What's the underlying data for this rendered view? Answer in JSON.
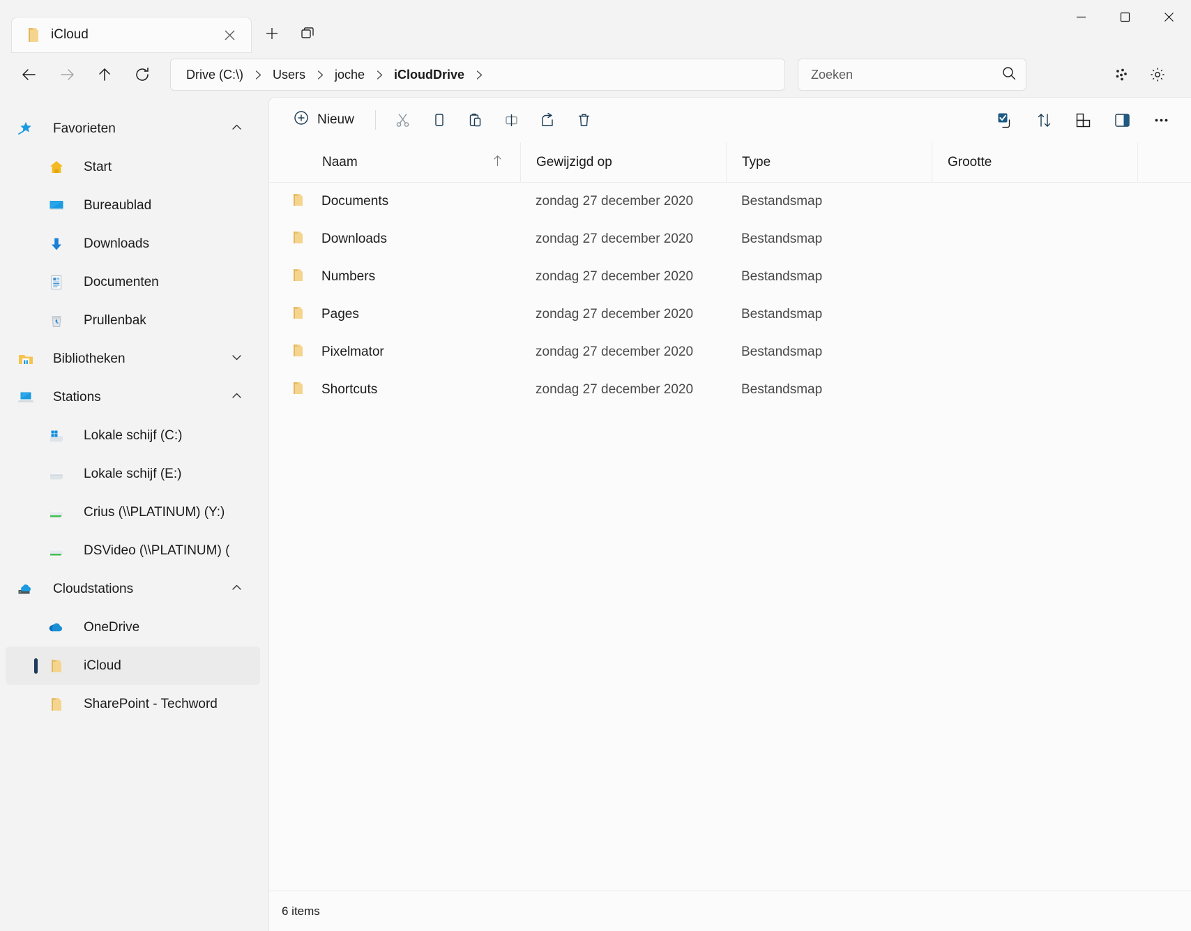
{
  "window": {
    "tab": {
      "title": "iCloud",
      "icon": "folder-icon",
      "close": "✕"
    },
    "controls": {
      "minimize": "minimize-icon",
      "maximize": "maximize-icon",
      "close": "close-icon"
    },
    "new_tab_label": "new-tab-icon",
    "tab_list_label": "tab-list-icon"
  },
  "navigation": {
    "back": "back-arrow-icon",
    "forward": "forward-arrow-icon",
    "up": "up-arrow-icon",
    "refresh": "refresh-icon",
    "breadcrumb": [
      {
        "label": "Drive (C:\\)",
        "current": false
      },
      {
        "label": "Users",
        "current": false
      },
      {
        "label": "joche",
        "current": false
      },
      {
        "label": "iCloudDrive",
        "current": true
      }
    ],
    "separator": "›"
  },
  "search": {
    "placeholder": "Zoeken",
    "value": "",
    "icon": "search-icon"
  },
  "addr_right": {
    "more": "details-dots-icon",
    "settings": "gear-icon"
  },
  "toolbar": {
    "new_label": "Nieuw",
    "new_icon": "plus-circle-icon",
    "cut": "cut-icon",
    "copy": "copy-icon",
    "paste": "paste-icon",
    "rename": "rename-icon",
    "share": "share-icon",
    "delete": "delete-icon",
    "select_all": "checkbox-select-icon",
    "sort": "sort-icon",
    "view": "view-layout-icon",
    "details_pane": "details-pane-icon",
    "more": "more-options-icon"
  },
  "columns": [
    {
      "key": "name",
      "label": "Naam",
      "sorted": "asc",
      "sort_icon": "↑"
    },
    {
      "key": "mod",
      "label": "Gewijzigd op"
    },
    {
      "key": "type",
      "label": "Type"
    },
    {
      "key": "size",
      "label": "Grootte"
    }
  ],
  "files": [
    {
      "name": "Documents",
      "modified": "zondag 27 december 2020",
      "type": "Bestandsmap",
      "size": "",
      "icon": "folder-icon"
    },
    {
      "name": "Downloads",
      "modified": "zondag 27 december 2020",
      "type": "Bestandsmap",
      "size": "",
      "icon": "folder-icon"
    },
    {
      "name": "Numbers",
      "modified": "zondag 27 december 2020",
      "type": "Bestandsmap",
      "size": "",
      "icon": "folder-icon"
    },
    {
      "name": "Pages",
      "modified": "zondag 27 december 2020",
      "type": "Bestandsmap",
      "size": "",
      "icon": "folder-icon"
    },
    {
      "name": "Pixelmator",
      "modified": "zondag 27 december 2020",
      "type": "Bestandsmap",
      "size": "",
      "icon": "folder-icon"
    },
    {
      "name": "Shortcuts",
      "modified": "zondag 27 december 2020",
      "type": "Bestandsmap",
      "size": "",
      "icon": "folder-icon"
    }
  ],
  "status": {
    "items_text": "6 items"
  },
  "sidebar": {
    "groups": [
      {
        "label": "Favorieten",
        "icon": "star-pin-icon",
        "expanded": true,
        "chevron": "⌃",
        "items": [
          {
            "label": "Start",
            "icon": "home-icon",
            "selected": false
          },
          {
            "label": "Bureaublad",
            "icon": "desktop-icon",
            "selected": false
          },
          {
            "label": "Downloads",
            "icon": "download-icon",
            "selected": false
          },
          {
            "label": "Documenten",
            "icon": "document-icon",
            "selected": false
          },
          {
            "label": "Prullenbak",
            "icon": "recycle-bin-icon",
            "selected": false
          }
        ]
      },
      {
        "label": "Bibliotheken",
        "icon": "libraries-icon",
        "expanded": false,
        "chevron": "⌄",
        "items": []
      },
      {
        "label": "Stations",
        "icon": "this-pc-icon",
        "expanded": true,
        "chevron": "⌃",
        "items": [
          {
            "label": "Lokale schijf (C:)",
            "icon": "system-drive-icon",
            "selected": false
          },
          {
            "label": "Lokale schijf (E:)",
            "icon": "drive-icon",
            "selected": false
          },
          {
            "label": "Crius (\\\\PLATINUM) (Y:)",
            "icon": "network-drive-icon",
            "selected": false
          },
          {
            "label": "DSVideo (\\\\PLATINUM) (",
            "icon": "network-drive-icon",
            "selected": false
          }
        ]
      },
      {
        "label": "Cloudstations",
        "icon": "cloud-drive-icon",
        "expanded": true,
        "chevron": "⌃",
        "items": [
          {
            "label": "OneDrive",
            "icon": "onedrive-icon",
            "selected": false
          },
          {
            "label": "iCloud",
            "icon": "folder-icon",
            "selected": true
          },
          {
            "label": "SharePoint - Techword",
            "icon": "folder-icon",
            "selected": false
          }
        ]
      }
    ]
  },
  "colors": {
    "accent": "#0f6cbd",
    "selection_bar": "#1d3a5c",
    "folder": "#f7d08a",
    "icon_stroke": "#1b3a52"
  }
}
